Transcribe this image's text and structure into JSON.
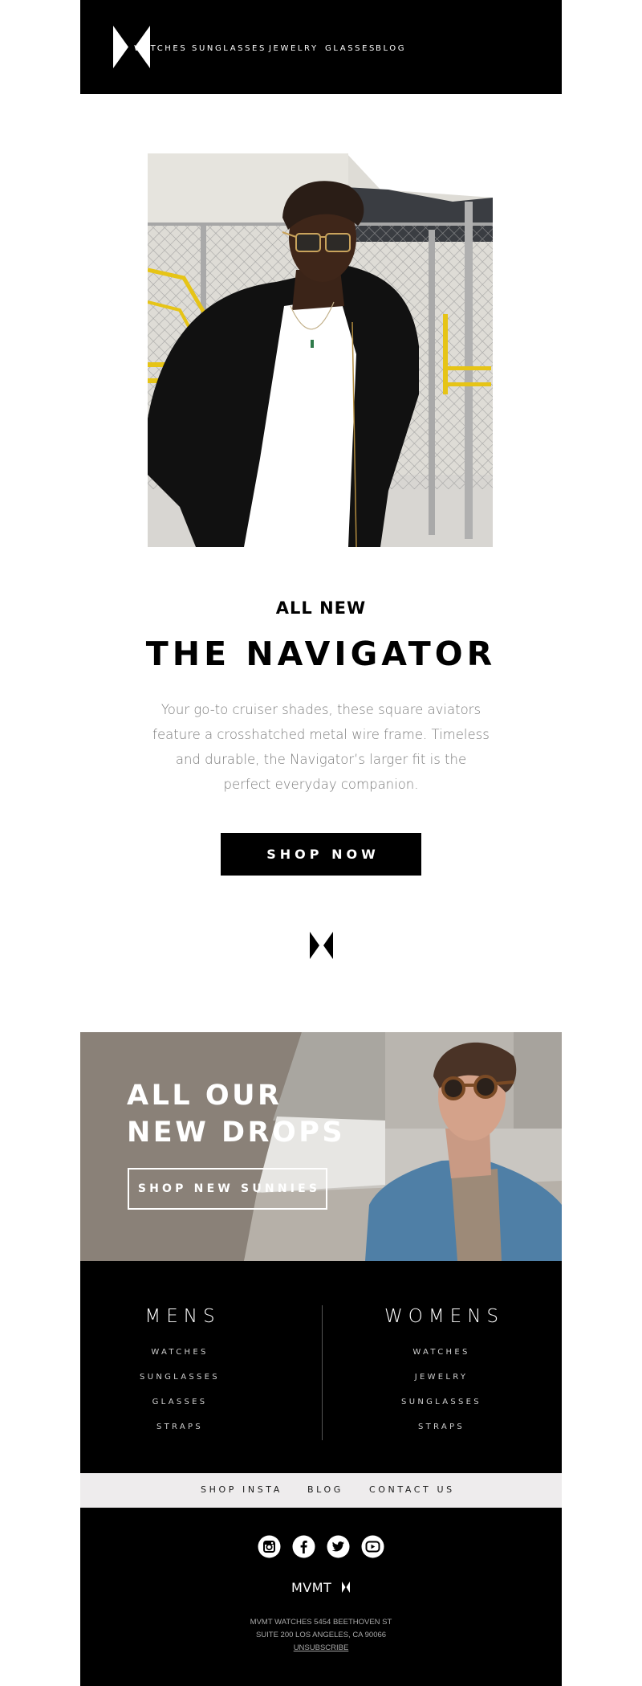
{
  "header": {
    "logo": "mvmt-logo-icon",
    "nav": [
      {
        "label": "WATCHES"
      },
      {
        "label": "SUNGLASSES"
      },
      {
        "label": "JEWELRY"
      },
      {
        "label": "GLASSES"
      },
      {
        "label": "BLOG"
      }
    ]
  },
  "hero": {
    "image_alt": "Man in black jacket and white tee wearing gold square aviator sunglasses by a chain-link fence",
    "eyebrow": "ALL NEW",
    "title": "THE NAVIGATOR",
    "description": "Your go-to cruiser shades, these square aviators feature a crosshatched metal wire frame. Timeless and durable, the Navigator’s larger fit is the perfect everyday companion.",
    "cta": "SHOP NOW"
  },
  "divider_logo": "mvmt-logo-icon",
  "banner": {
    "title_line1": "ALL OUR",
    "title_line2": "NEW DROPS",
    "cta": "SHOP NEW SUNNIES",
    "image_alt": "Man in denim jacket wearing tortoise round sunglasses",
    "bg_color": "#8a8178"
  },
  "categories": {
    "mens": {
      "heading": "MENS",
      "items": [
        "WATCHES",
        "SUNGLASSES",
        "GLASSES",
        "STRAPS"
      ]
    },
    "womens": {
      "heading": "WOMENS",
      "items": [
        "WATCHES",
        "JEWELRY",
        "SUNGLASSES",
        "STRAPS"
      ]
    }
  },
  "utility_links": [
    {
      "label": "SHOP INSTA"
    },
    {
      "label": "BLOG"
    },
    {
      "label": "CONTACT US"
    }
  ],
  "footer": {
    "social": [
      {
        "icon": "instagram-icon"
      },
      {
        "icon": "facebook-icon"
      },
      {
        "icon": "twitter-icon"
      },
      {
        "icon": "youtube-icon"
      }
    ],
    "wordmark": "MVMT",
    "address_line1": "MVMT WATCHES 5454 BEETHOVEN ST",
    "address_line2": "SUITE 200 LOS ANGELES, CA 90066",
    "unsubscribe": "UNSUBSCRIBE"
  }
}
